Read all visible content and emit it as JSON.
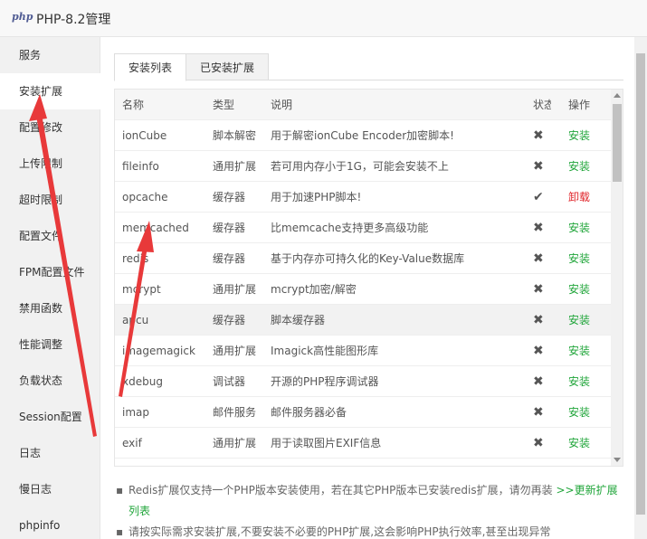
{
  "window": {
    "logo": "php",
    "title": "PHP-8.2管理"
  },
  "sidebar": {
    "items": [
      {
        "label": "服务"
      },
      {
        "label": "安装扩展",
        "active": true
      },
      {
        "label": "配置修改"
      },
      {
        "label": "上传限制"
      },
      {
        "label": "超时限制"
      },
      {
        "label": "配置文件"
      },
      {
        "label": "FPM配置文件"
      },
      {
        "label": "禁用函数"
      },
      {
        "label": "性能调整"
      },
      {
        "label": "负载状态"
      },
      {
        "label": "Session配置"
      },
      {
        "label": "日志"
      },
      {
        "label": "慢日志"
      },
      {
        "label": "phpinfo"
      }
    ]
  },
  "tabs": [
    {
      "label": "安装列表",
      "active": true
    },
    {
      "label": "已安装扩展",
      "active": false
    }
  ],
  "table": {
    "headers": {
      "name": "名称",
      "type": "类型",
      "desc": "说明",
      "status": "状态",
      "op": "操作"
    },
    "rows": [
      {
        "name": "ionCube",
        "type": "脚本解密",
        "desc": "用于解密ionCube Encoder加密脚本!",
        "status": "✖",
        "op": "安装"
      },
      {
        "name": "fileinfo",
        "type": "通用扩展",
        "desc": "若可用内存小于1G，可能会安装不上",
        "status": "✖",
        "op": "安装"
      },
      {
        "name": "opcache",
        "type": "缓存器",
        "desc": "用于加速PHP脚本!",
        "status": "✔",
        "op": "卸载"
      },
      {
        "name": "memcached",
        "type": "缓存器",
        "desc": "比memcache支持更多高级功能",
        "status": "✖",
        "op": "安装"
      },
      {
        "name": "redis",
        "type": "缓存器",
        "desc": "基于内存亦可持久化的Key-Value数据库",
        "status": "✖",
        "op": "安装"
      },
      {
        "name": "mcrypt",
        "type": "通用扩展",
        "desc": "mcrypt加密/解密",
        "status": "✖",
        "op": "安装"
      },
      {
        "name": "apcu",
        "type": "缓存器",
        "desc": "脚本缓存器",
        "status": "✖",
        "op": "安装"
      },
      {
        "name": "imagemagick",
        "type": "通用扩展",
        "desc": "Imagick高性能图形库",
        "status": "✖",
        "op": "安装"
      },
      {
        "name": "xdebug",
        "type": "调试器",
        "desc": "开源的PHP程序调试器",
        "status": "✖",
        "op": "安装"
      },
      {
        "name": "imap",
        "type": "邮件服务",
        "desc": "邮件服务器必备",
        "status": "✖",
        "op": "安装"
      },
      {
        "name": "exif",
        "type": "通用扩展",
        "desc": "用于读取图片EXIF信息",
        "status": "✖",
        "op": "安装"
      }
    ]
  },
  "notes": {
    "bullet": "▪",
    "redis_text": "Redis扩展仅支持一个PHP版本安装使用，若在其它PHP版本已安装redis扩展，请勿再装",
    "update_link": ">>更新扩展列表",
    "advice_text": "请按实际需求安装扩展,不要安装不必要的PHP扩展,这会影响PHP执行效率,甚至出现异常"
  },
  "colors": {
    "install": "#20a53a",
    "uninstall": "#e0262b",
    "annotation_arrow": "#e8393a"
  }
}
